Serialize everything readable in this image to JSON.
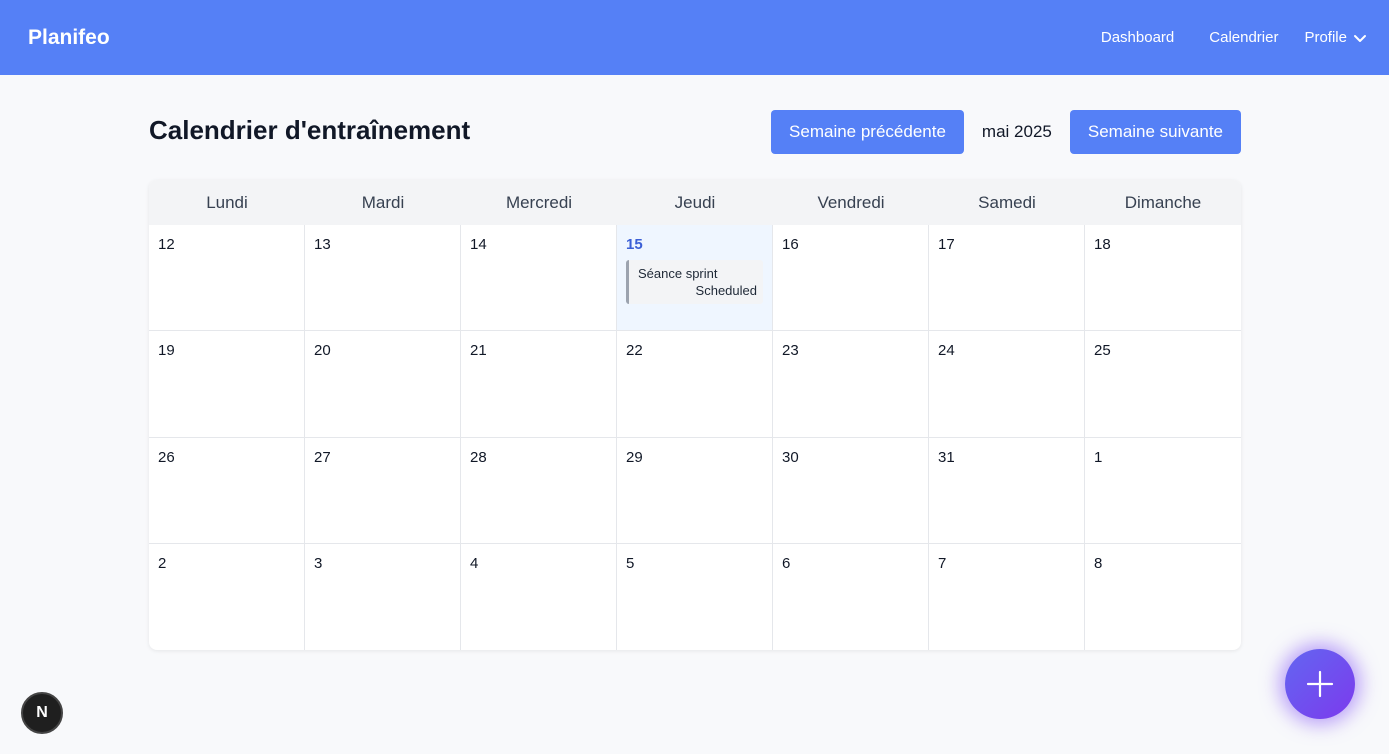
{
  "header": {
    "brand": "Planifeo",
    "nav": [
      "Dashboard",
      "Calendrier"
    ],
    "profile_label": "Profile"
  },
  "page": {
    "title": "Calendrier d'entraînement",
    "prev_week_label": "Semaine précédente",
    "current_month": "mai 2025",
    "next_week_label": "Semaine suivante"
  },
  "calendar": {
    "weekdays": [
      "Lundi",
      "Mardi",
      "Mercredi",
      "Jeudi",
      "Vendredi",
      "Samedi",
      "Dimanche"
    ],
    "today": "15",
    "days": [
      "12",
      "13",
      "14",
      "15",
      "16",
      "17",
      "18",
      "19",
      "20",
      "21",
      "22",
      "23",
      "24",
      "25",
      "26",
      "27",
      "28",
      "29",
      "30",
      "31",
      "1",
      "2",
      "3",
      "4",
      "5",
      "6",
      "7",
      "8"
    ],
    "events": [
      {
        "day": "15",
        "title": "Séance sprint",
        "status": "Scheduled"
      }
    ]
  },
  "floating": {
    "add_icon": "plus-icon",
    "dev_badge": "N"
  },
  "colors": {
    "primary": "#5580f6",
    "today_bg": "#eff6ff",
    "fab_gradient": [
      "#6366f1",
      "#7c3aed"
    ]
  }
}
